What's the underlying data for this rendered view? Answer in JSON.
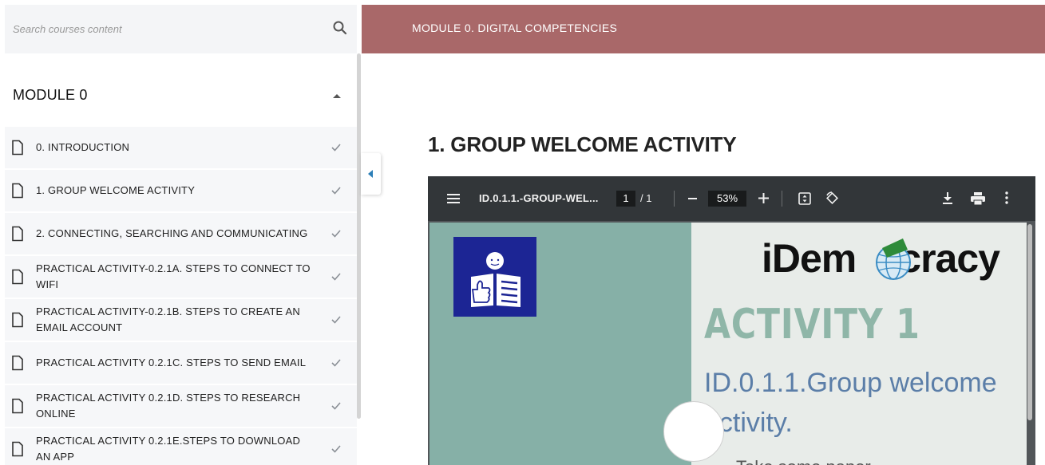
{
  "search": {
    "placeholder": "Search courses content"
  },
  "module": {
    "title": "MODULE 0"
  },
  "sidebar": {
    "items": [
      {
        "label": "0. INTRODUCTION"
      },
      {
        "label": "1. GROUP WELCOME ACTIVITY"
      },
      {
        "label": "2. CONNECTING, SEARCHING AND COMMUNICATING"
      },
      {
        "label": "PRACTICAL ACTIVITY-0.2.1A. STEPS TO CONNECT TO WIFI"
      },
      {
        "label": "PRACTICAL ACTIVITY-0.2.1B. STEPS TO CREATE AN EMAIL ACCOUNT"
      },
      {
        "label": "PRACTICAL ACTIVITY 0.2.1C. STEPS TO SEND EMAIL"
      },
      {
        "label": "PRACTICAL ACTIVITY 0.2.1D. STEPS TO RESEARCH ONLINE"
      },
      {
        "label": "PRACTICAL ACTIVITY 0.2.1E.STEPS TO DOWNLOAD AN APP"
      }
    ]
  },
  "header": {
    "title": "MODULE 0. DIGITAL COMPETENCIES"
  },
  "main": {
    "title": "1. GROUP WELCOME ACTIVITY"
  },
  "pdf": {
    "filename": "ID.0.1.1.-GROUP-WEL...",
    "page_current": "1",
    "page_total": "/  1",
    "zoom": "53%",
    "brand_left": "iDem",
    "brand_right": "cracy",
    "heading": "ACTIVITY 1",
    "subtitle": "ID.0.1.1.Group welcome activity.",
    "partial_text": "Take some paper"
  },
  "colors": {
    "header_bg": "#a96869",
    "pdf_toolbar": "#323639",
    "page_left_panel": "#86b0a7",
    "easy_read_icon": "#1c2594"
  }
}
